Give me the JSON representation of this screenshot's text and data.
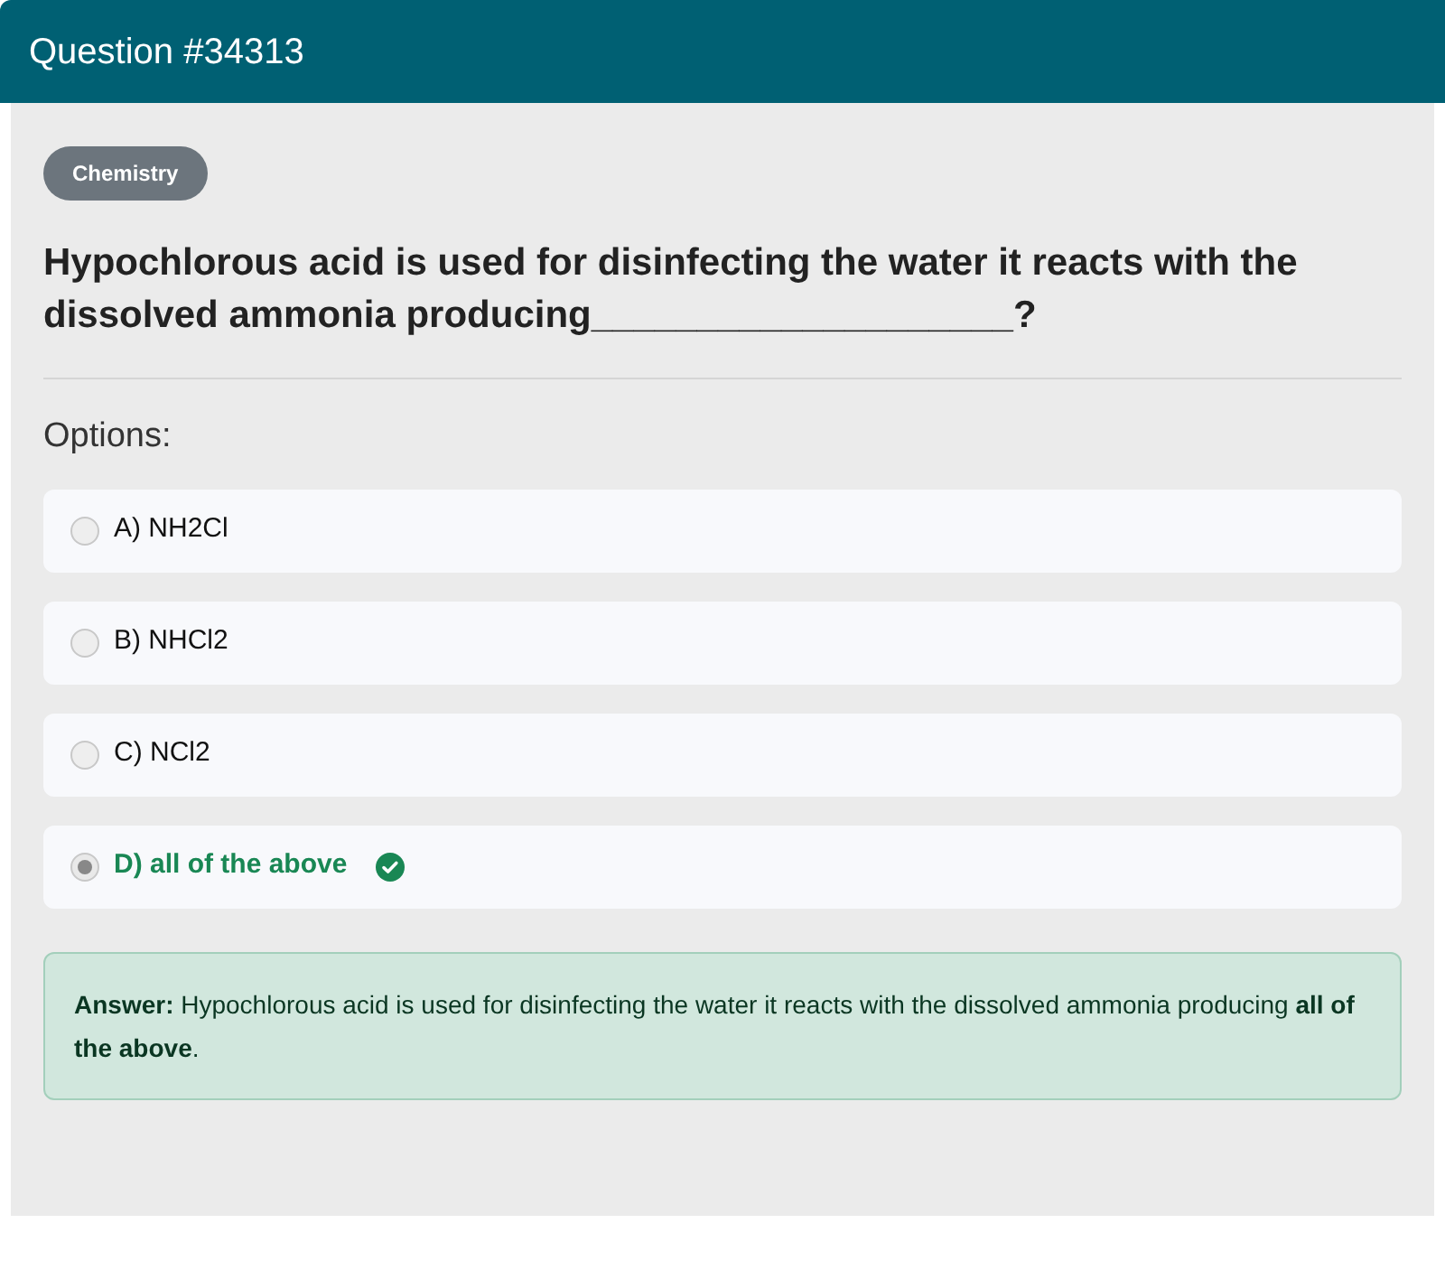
{
  "header": {
    "title": "Question #34313"
  },
  "category": "Chemistry",
  "question": "Hypochlorous acid is used for disinfecting the water it reacts with the dissolved ammonia producing____________________?",
  "options_label": "Options:",
  "options": [
    {
      "label": "A) NH2Cl",
      "selected": false,
      "correct": false
    },
    {
      "label": "B) NHCl2",
      "selected": false,
      "correct": false
    },
    {
      "label": "C) NCl2",
      "selected": false,
      "correct": false
    },
    {
      "label": "D) all of the above",
      "selected": true,
      "correct": true
    }
  ],
  "answer": "**Answer:** Hypochlorous acid is used for disinfecting the water it reacts with the dissolved ammonia producing **all of the above**."
}
